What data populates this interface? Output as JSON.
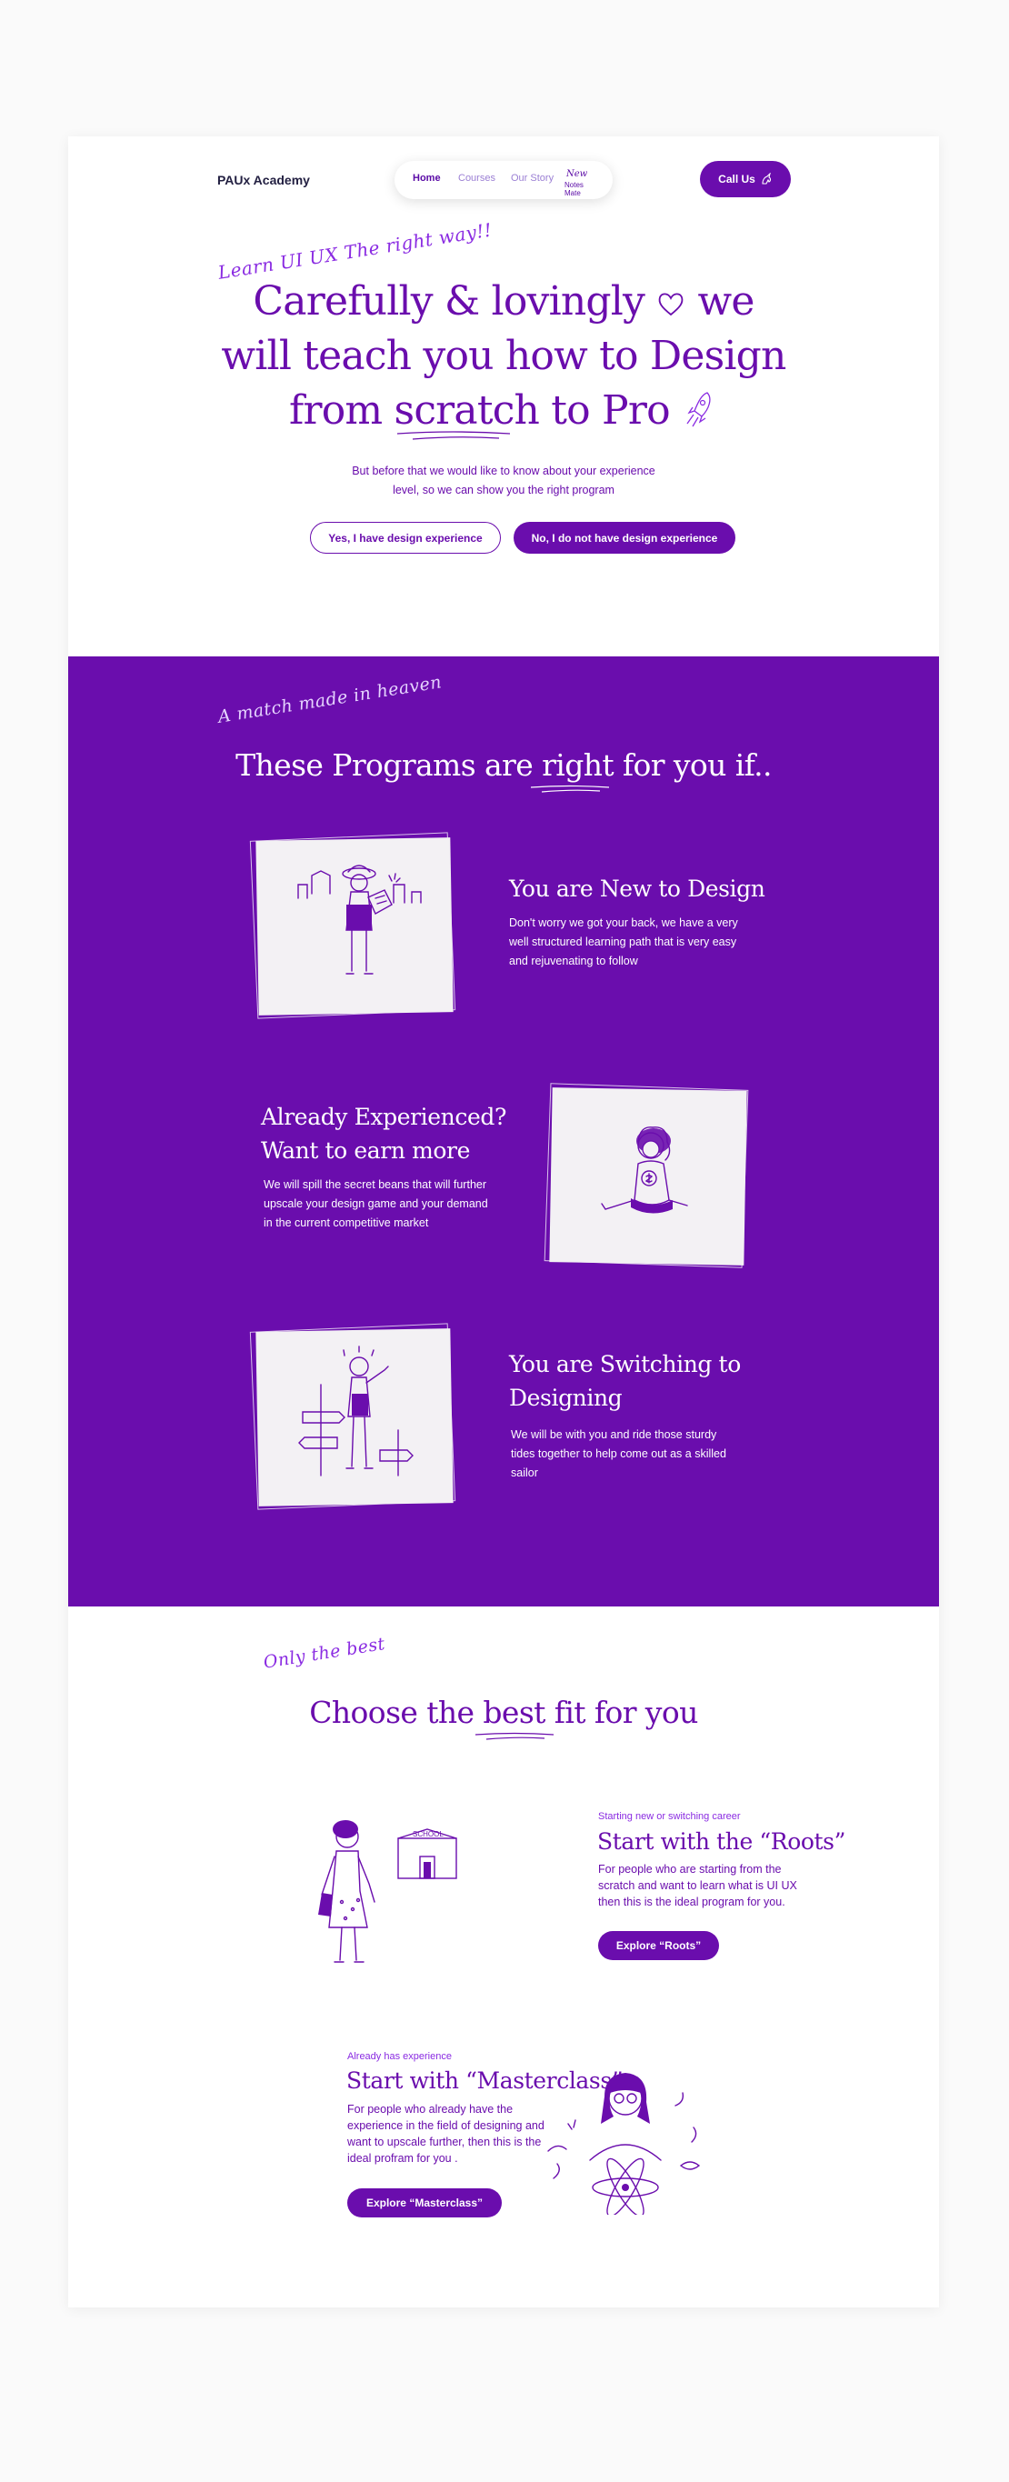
{
  "nav": {
    "brand": "PAUx Academy",
    "links": [
      {
        "label": "Home",
        "active": true
      },
      {
        "label": "Courses",
        "active": false
      },
      {
        "label": "Our Story",
        "active": false
      }
    ],
    "newmark_top": "New",
    "newmark_bottom": "Notes Mate",
    "call_label": "Call Us",
    "call_icon": "unicorn-icon"
  },
  "hero": {
    "script": "Learn UI UX The right way!!",
    "title_line1_a": "Carefully & lovingly",
    "title_line1_b": "we",
    "title_line2": "will teach you how to Design",
    "title_line3_a": "from",
    "title_line3_b": "scratch",
    "title_line3_c": "to Pro",
    "subtitle_line1": "But before that we would like to know about your experience",
    "subtitle_line2": "level, so we can show you the right program",
    "btn_yes": "Yes, I have design experience",
    "btn_no": "No, I do not have design experience"
  },
  "programs": {
    "script": "A match made in heaven",
    "title_a": "These Programs are",
    "title_b": "right",
    "title_c": "for you if..",
    "items": [
      {
        "heading_line1": "You are New to Design",
        "heading_line2": "",
        "body_lines": [
          "Don't worry we got your back, we have a very",
          "well structured learning path that is very easy",
          "and rejuvenating to follow"
        ]
      },
      {
        "heading_line1": "Already Experienced?",
        "heading_line2": "Want to earn more",
        "body_lines": [
          "We will spill the secret beans that will further",
          "upscale your design game and your demand",
          "in the current competitive market"
        ]
      },
      {
        "heading_line1": "You are Switching to",
        "heading_line2": "Designing",
        "body_lines": [
          "We will be with you and  ride those sturdy",
          "tides  together to help come out as a skilled",
          "sailor"
        ]
      }
    ]
  },
  "choose": {
    "script": "Only the best",
    "title_a": "Choose the",
    "title_b": "best",
    "title_c": "fit for you",
    "roots": {
      "label": "Starting new or switching career",
      "heading": "Start with the “Roots”",
      "body_lines": [
        "For people who are starting from the",
        "scratch and want to learn what is UI UX",
        "then this is the ideal program for you."
      ],
      "button": "Explore “Roots”",
      "sign": "SCHOOL"
    },
    "masterclass": {
      "label": "Already has experience",
      "heading": "Start with “Masterclass”",
      "body_lines": [
        "For people who already have the",
        "experience in the field of designing and",
        "want to upscale further, then this is the",
        "ideal profram for you ."
      ],
      "button": "Explore “Masterclass”"
    }
  },
  "colors": {
    "primary": "#6a0dad",
    "accent": "#8a2be2",
    "background": "#fafafa",
    "card": "#ffffff",
    "dark_text": "#232042"
  }
}
